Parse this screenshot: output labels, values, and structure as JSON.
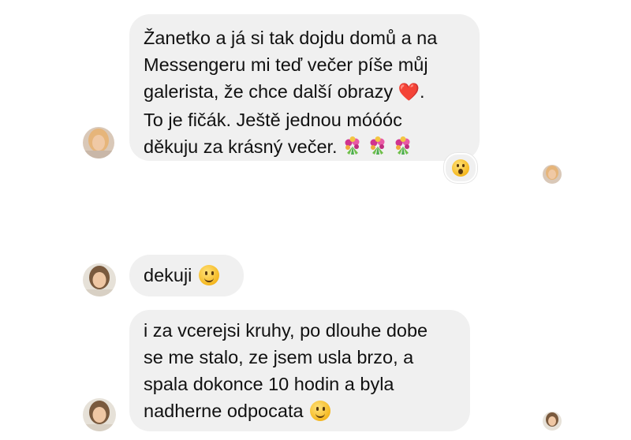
{
  "messages": [
    {
      "lines": [
        "Žanetko a já si tak dojdu domů a na",
        "Messengeru mi teď večer píše můj",
        "galerista, že chce další obrazy",
        "To je fičák. Ještě jednou móóóc",
        "děkuju za krásný večer."
      ],
      "heart_emoji": "❤️",
      "heart_suffix": ".",
      "flower_emoji_count": 3,
      "reaction": "wow-emoji"
    },
    {
      "lines": [
        "dekuji"
      ],
      "trailing_emoji": "smile-emoji"
    },
    {
      "lines": [
        "i za vcerejsi kruhy, po dlouhe dobe",
        "se me stalo, ze jsem usla brzo, a",
        "spala dokonce 10 hodin a byla",
        "nadherne odpocata"
      ],
      "trailing_emoji": "smile-emoji"
    }
  ],
  "colors": {
    "bubble_bg": "#f0f0f0",
    "text": "#111111",
    "heart": "#e0242c"
  }
}
